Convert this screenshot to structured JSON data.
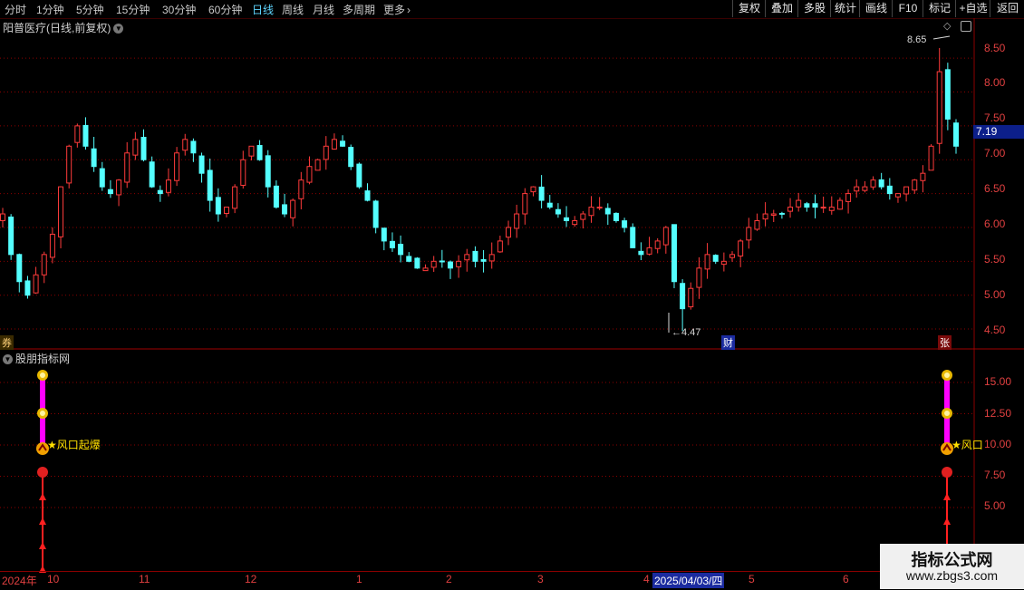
{
  "toolbar": {
    "timeframes": [
      "分时",
      "1分钟",
      "5分钟",
      "15分钟",
      "30分钟",
      "60分钟",
      "日线",
      "周线",
      "月线",
      "多周期",
      "更多"
    ],
    "active_timeframe": "日线",
    "more_icon": "chevron-right-icon",
    "buttons": [
      "复权",
      "叠加",
      "多股",
      "统计",
      "画线",
      "F10",
      "标记",
      "+自选",
      "返回"
    ]
  },
  "price_panel": {
    "title": "阳普医疗(日线,前复权)",
    "price_labels": [
      "8.50",
      "8.00",
      "7.50",
      "7.00",
      "6.50",
      "6.00",
      "5.50",
      "5.00",
      "4.50"
    ],
    "current_price": "7.19",
    "high_annotation": "8.65",
    "low_annotation": "4.47",
    "marker_left": "券",
    "marker_cai": "财",
    "marker_zhang": "张",
    "colors": {
      "up": "#ff3b3b",
      "down": "#54ffff",
      "grid": "#8b0000"
    }
  },
  "indicator_panel": {
    "title": "股朋指标网",
    "axis_labels": [
      "15.00",
      "12.50",
      "10.00",
      "7.50",
      "5.00"
    ],
    "signal_label_1": "风口起爆",
    "signal_label_2": "风口",
    "icons": [
      "money-bag-icon",
      "rocket-icon",
      "up-arrow-icon"
    ]
  },
  "date_axis": {
    "year_label": "2024年",
    "months": [
      "10",
      "11",
      "12",
      "1",
      "2",
      "3",
      "4",
      "5",
      "6"
    ],
    "selected_date": "2025/04/03/四"
  },
  "watermark": {
    "line1": "指标公式网",
    "line2": "www.zbgs3.com"
  },
  "chart_data": {
    "type": "candlestick",
    "ylim": [
      4.3,
      8.85
    ],
    "high": 8.65,
    "low": 4.47,
    "last": 7.19,
    "series": [
      {
        "values": [
          6.2,
          5.6,
          5.2,
          5.0,
          5.3,
          5.6,
          5.9,
          6.6,
          7.2,
          7.5,
          7.2,
          6.9,
          6.6,
          6.5,
          6.7,
          7.1,
          7.3,
          7.0,
          6.6,
          6.5,
          6.7,
          7.1,
          7.3,
          7.1,
          6.8,
          6.4,
          6.2,
          6.3,
          6.6,
          7.0,
          7.2,
          7.0,
          6.6,
          6.3,
          6.2,
          6.4,
          6.7,
          6.9,
          7.0,
          7.2,
          7.3,
          7.2,
          6.9,
          6.6,
          6.4,
          6.0,
          5.8,
          5.7,
          5.6,
          5.5,
          5.4,
          5.4,
          5.5,
          5.5,
          5.4,
          5.5,
          5.6,
          5.5,
          5.5,
          5.6,
          5.8,
          6.0,
          6.2,
          6.5,
          6.6,
          6.4,
          6.3,
          6.2,
          6.1,
          6.1,
          6.2,
          6.3,
          6.3,
          6.2,
          6.1,
          6.0,
          5.7,
          5.6,
          5.7,
          5.8,
          6.0,
          5.2,
          4.8,
          5.1,
          5.4,
          5.6,
          5.5,
          5.5,
          5.6,
          5.8,
          6.0,
          6.1,
          6.2,
          6.2,
          6.2,
          6.3,
          6.4,
          6.3,
          6.3,
          6.3,
          6.3,
          6.4,
          6.5,
          6.6,
          6.6,
          6.7,
          6.6,
          6.5,
          6.5,
          6.6,
          6.7,
          6.8,
          7.2,
          8.3,
          7.6,
          7.2
        ]
      }
    ]
  }
}
